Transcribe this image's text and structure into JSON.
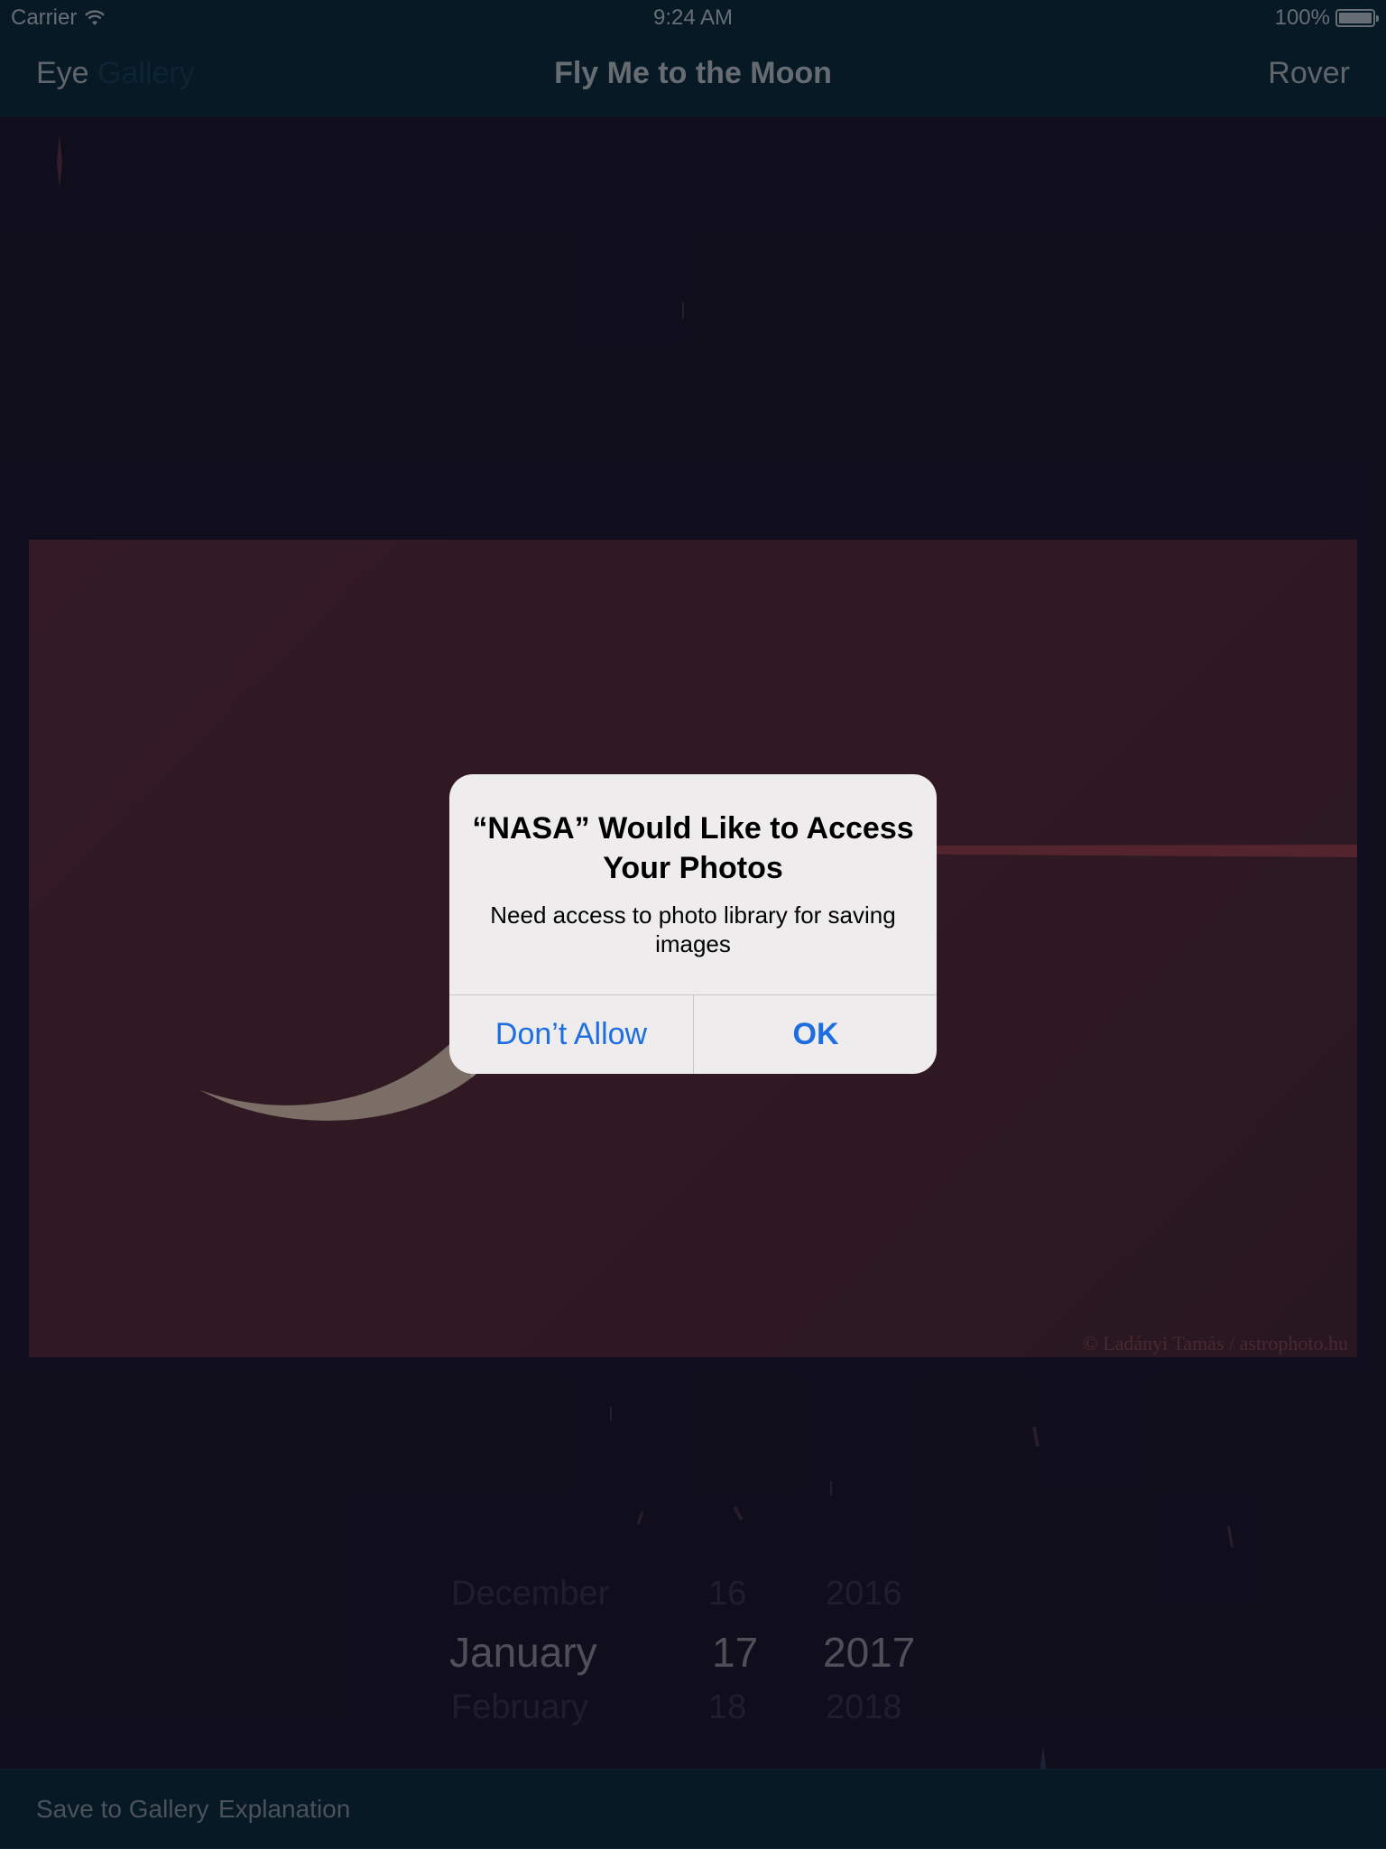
{
  "status_bar": {
    "carrier": "Carrier",
    "time": "9:24 AM",
    "battery": "100%"
  },
  "nav": {
    "left": "Eye",
    "left_faint": "Gallery",
    "title": "Fly Me to the Moon",
    "right": "Rover"
  },
  "photo": {
    "credit": "© Ladányi Tamás / astrophoto.hu"
  },
  "alert": {
    "title": "“NASA” Would Like to Access Your Photos",
    "message": "Need access to photo library for saving images",
    "deny_label": "Don’t Allow",
    "ok_label": "OK"
  },
  "picker": {
    "months": [
      "December",
      "January",
      "February"
    ],
    "days": [
      "16",
      "17",
      "18"
    ],
    "years": [
      "2016",
      "2017",
      "2018"
    ],
    "selected_index": 1
  },
  "toolbar": {
    "save_label": "Save to Gallery",
    "explanation_label": "Explanation"
  },
  "colors": {
    "bars": "#062231",
    "background": "#141222",
    "alert_button": "#1d6ee0"
  }
}
